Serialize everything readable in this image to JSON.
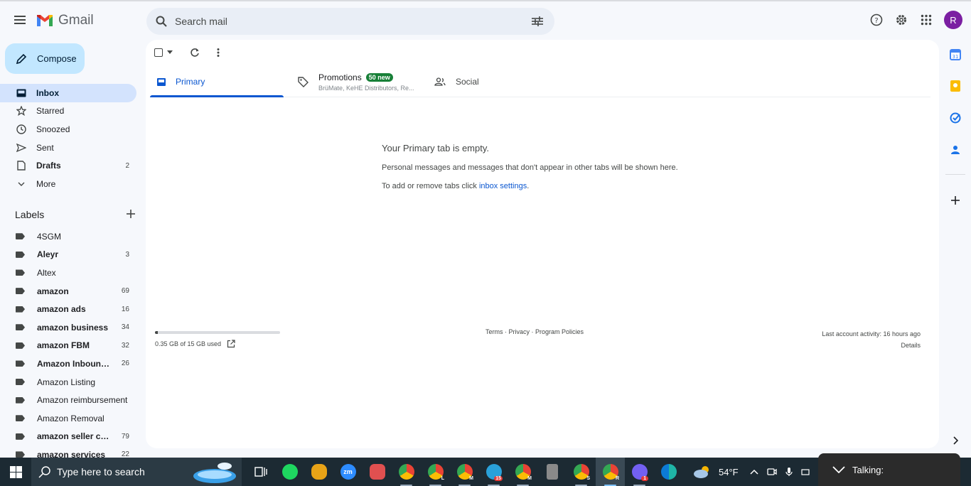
{
  "app": {
    "name": "Gmail"
  },
  "search": {
    "placeholder": "Search mail"
  },
  "header": {
    "avatar_letter": "R"
  },
  "compose": {
    "label": "Compose"
  },
  "nav": [
    {
      "label": "Inbox",
      "count": "",
      "icon": "inbox-icon",
      "active": true,
      "bold": true
    },
    {
      "label": "Starred",
      "count": "",
      "icon": "star-icon"
    },
    {
      "label": "Snoozed",
      "count": "",
      "icon": "clock-icon"
    },
    {
      "label": "Sent",
      "count": "",
      "icon": "send-icon"
    },
    {
      "label": "Drafts",
      "count": "2",
      "icon": "draft-icon",
      "bold": true
    },
    {
      "label": "More",
      "count": "",
      "icon": "chevron-down-icon"
    }
  ],
  "labels": {
    "title": "Labels",
    "items": [
      {
        "name": "4SGM",
        "count": "",
        "bold": false
      },
      {
        "name": "Aleyr",
        "count": "3",
        "bold": true
      },
      {
        "name": "Altex",
        "count": "",
        "bold": false
      },
      {
        "name": "amazon",
        "count": "69",
        "bold": true
      },
      {
        "name": "amazon ads",
        "count": "16",
        "bold": true
      },
      {
        "name": "amazon business",
        "count": "34",
        "bold": true
      },
      {
        "name": "amazon FBM",
        "count": "32",
        "bold": true
      },
      {
        "name": "Amazon Inbound ...",
        "count": "26",
        "bold": true
      },
      {
        "name": "Amazon Listing",
        "count": "",
        "bold": false
      },
      {
        "name": "Amazon reimbursement",
        "count": "",
        "bold": false
      },
      {
        "name": "Amazon Removal",
        "count": "",
        "bold": false
      },
      {
        "name": "amazon seller cen...",
        "count": "79",
        "bold": true
      },
      {
        "name": "amazon services",
        "count": "22",
        "bold": true
      }
    ]
  },
  "tabs": {
    "primary": "Primary",
    "promotions": "Promotions",
    "promotions_badge": "50 new",
    "promotions_sub": "BrüMate, KeHE Distributors, Re...",
    "social": "Social"
  },
  "empty_state": {
    "title": "Your Primary tab is empty.",
    "line1": "Personal messages and messages that don't appear in other tabs will be shown here.",
    "line2_prefix": "To add or remove tabs click ",
    "line2_link": "inbox settings",
    "line2_suffix": "."
  },
  "storage": {
    "text": "0.35 GB of 15 GB used",
    "fraction": 0.023
  },
  "footer": {
    "links": "Terms · Privacy · Program Policies"
  },
  "activity": {
    "line1": "Last account activity: 16 hours ago",
    "line2": "Details"
  },
  "taskbar": {
    "search_placeholder": "Type here to search",
    "temperature": "54°F",
    "talking": "Talking:",
    "apps": [
      {
        "name": "task-view-icon",
        "color": "#ffffff"
      },
      {
        "name": "spotify-icon",
        "color": "#1ed760"
      },
      {
        "name": "app-bird-icon",
        "color": "#e8a317"
      },
      {
        "name": "zoom-icon",
        "color": "#2d8cff",
        "label": "zm"
      },
      {
        "name": "snipping-tool-icon",
        "color": "#e05050"
      },
      {
        "name": "chrome-icon",
        "color": "#ea4335"
      },
      {
        "name": "chrome-L-icon",
        "color": "#34a853",
        "label": "L"
      },
      {
        "name": "chrome-M-icon",
        "color": "#fbbc05",
        "label": "M"
      },
      {
        "name": "telegram-icon",
        "color": "#2aa1da",
        "label": "15"
      },
      {
        "name": "chrome-M2-icon",
        "color": "#ea4335",
        "label": "M"
      },
      {
        "name": "calculator-icon",
        "color": "#8a8a8a"
      },
      {
        "name": "chrome-S-icon",
        "color": "#ea4335",
        "label": "S"
      },
      {
        "name": "chrome-R-icon",
        "color": "#7b1fa2",
        "label": "R",
        "active": true
      },
      {
        "name": "viber-icon",
        "color": "#7360f2",
        "label": "1"
      },
      {
        "name": "edge-icon",
        "color": "#1fb5a6"
      }
    ]
  }
}
